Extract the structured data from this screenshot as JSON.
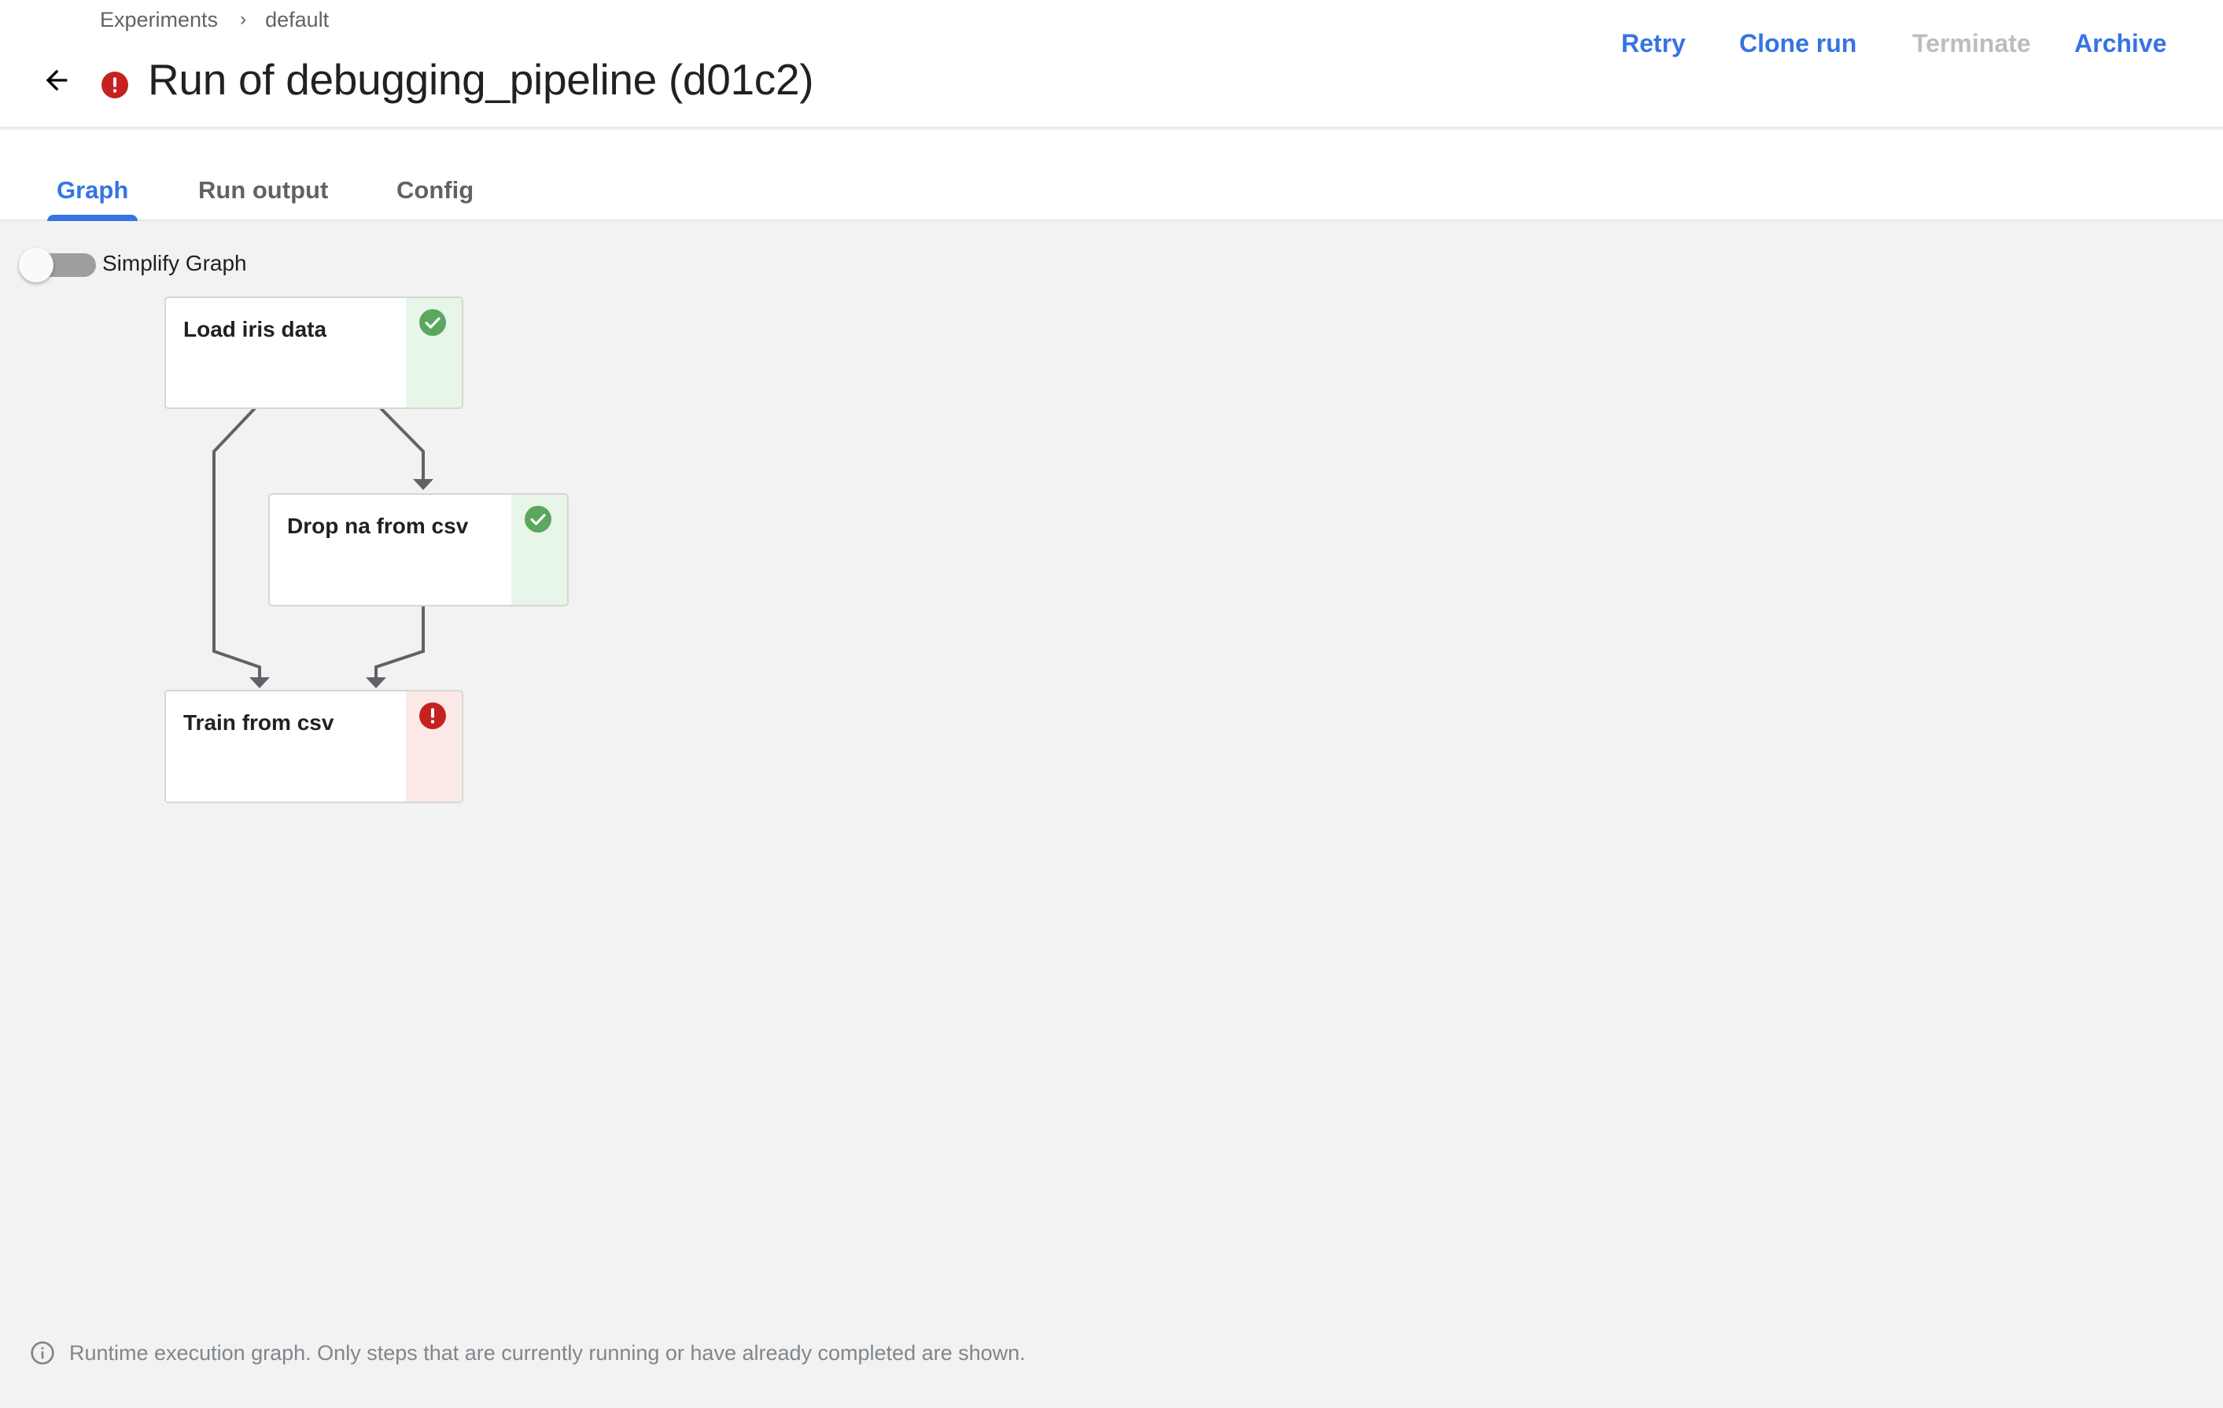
{
  "colors": {
    "accent": "#3574e2",
    "disabled": "#bdbdbd",
    "success": "#5aa75e",
    "error": "#c5221f",
    "success_bg": "#e8f5e9",
    "error_bg": "#fbe9e7",
    "edge": "#5f6368"
  },
  "breadcrumb": {
    "items": [
      {
        "label": "Experiments"
      },
      {
        "label": "default"
      }
    ],
    "separator": "›"
  },
  "header": {
    "back_icon": "arrow-back-icon",
    "status_icon": "error-icon",
    "title": "Run of debugging_pipeline (d01c2)"
  },
  "actions": [
    {
      "label": "Retry",
      "enabled": true
    },
    {
      "label": "Clone run",
      "enabled": true
    },
    {
      "label": "Terminate",
      "enabled": false
    },
    {
      "label": "Archive",
      "enabled": true
    }
  ],
  "tabs": [
    {
      "label": "Graph",
      "active": true
    },
    {
      "label": "Run output",
      "active": false
    },
    {
      "label": "Config",
      "active": false
    }
  ],
  "graph": {
    "simplify_toggle": {
      "label": "Simplify Graph",
      "checked": false
    },
    "nodes": [
      {
        "id": "load",
        "label": "Load iris data",
        "status": "success",
        "status_icon": "check-circle-icon"
      },
      {
        "id": "dropna",
        "label": "Drop na from csv",
        "status": "success",
        "status_icon": "check-circle-icon"
      },
      {
        "id": "train",
        "label": "Train from csv",
        "status": "error",
        "status_icon": "error-icon"
      }
    ],
    "edges": [
      {
        "from": "load",
        "to": "dropna"
      },
      {
        "from": "load",
        "to": "train"
      },
      {
        "from": "dropna",
        "to": "train"
      }
    ]
  },
  "footer": {
    "icon": "info-icon",
    "text": "Runtime execution graph. Only steps that are currently running or have already completed are shown."
  }
}
